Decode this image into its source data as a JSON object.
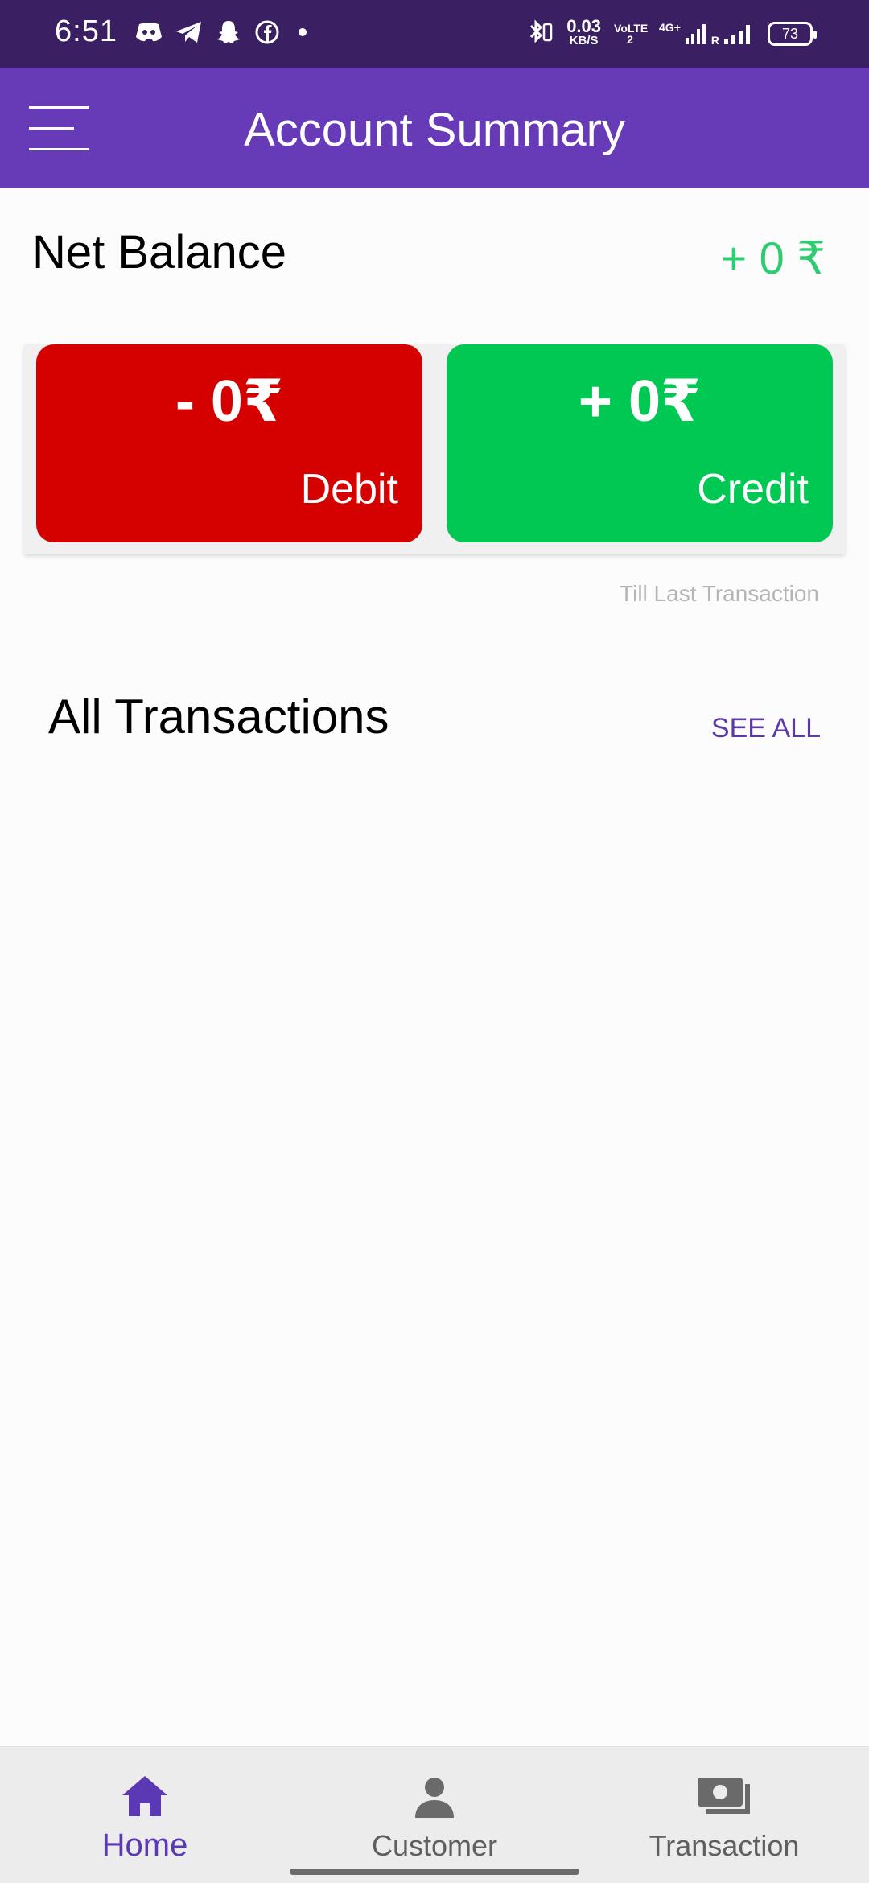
{
  "status_bar": {
    "time": "6:51",
    "net_speed_value": "0.03",
    "net_speed_unit": "KB/S",
    "volte_label": "VoLTE 2",
    "network_label": "4G+",
    "roaming_label": "R",
    "battery": "73",
    "icons": [
      "discord-icon",
      "telegram-icon",
      "snapchat-icon",
      "facebook-icon",
      "dot-icon",
      "bluetooth-icon",
      "signal-icon"
    ]
  },
  "app_bar": {
    "title": "Account Summary",
    "menu_icon": "hamburger-icon"
  },
  "net_balance": {
    "label": "Net Balance",
    "value": "+ 0 ₹"
  },
  "cards": {
    "debit": {
      "amount": "- 0₹",
      "label": "Debit",
      "color": "#d50000"
    },
    "credit": {
      "amount": "+ 0₹",
      "label": "Credit",
      "color": "#00c853"
    }
  },
  "till_note": "Till Last Transaction",
  "transactions": {
    "title": "All Transactions",
    "see_all": "SEE ALL",
    "items": []
  },
  "bottom_nav": {
    "items": [
      {
        "label": "Home",
        "icon": "home-icon",
        "active": true
      },
      {
        "label": "Customer",
        "icon": "person-icon",
        "active": false
      },
      {
        "label": "Transaction",
        "icon": "money-icon",
        "active": false
      }
    ]
  },
  "colors": {
    "primary": "#673ab7",
    "status_bar": "#3a2063",
    "positive": "#2ecc71",
    "accent_text": "#5b39a8"
  }
}
